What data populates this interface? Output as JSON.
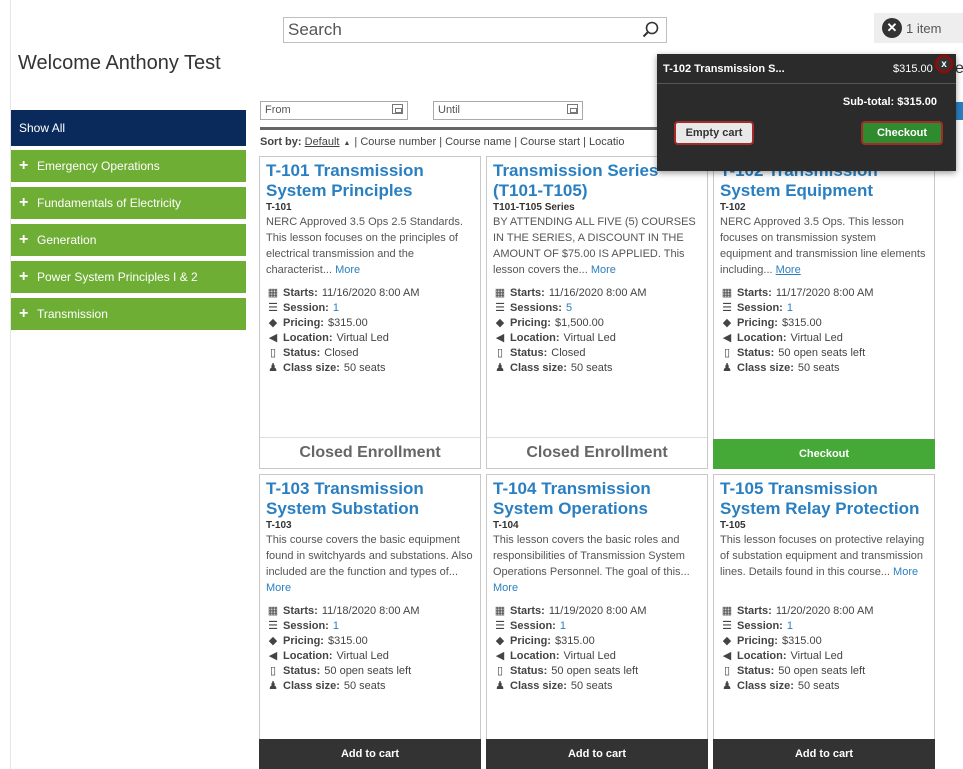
{
  "welcome": "Welcome Anthony Test",
  "search": {
    "placeholder": "Search"
  },
  "cart": {
    "count_label": "1 item"
  },
  "cart_popup": {
    "item_name": "T-102 Transmission S...",
    "item_price": "$315.00",
    "close_label": "x",
    "subtotal": "Sub-total: $315.00",
    "empty_label": "Empty cart",
    "checkout_label": "Checkout"
  },
  "edge_fragment": "es",
  "sidebar": {
    "show_all": "Show All",
    "items": [
      {
        "label": "Emergency Operations"
      },
      {
        "label": "Fundamentals of Electricity"
      },
      {
        "label": "Generation"
      },
      {
        "label": "Power System Principles I & 2"
      },
      {
        "label": "Transmission"
      }
    ]
  },
  "filters": {
    "from": "From",
    "until": "Until"
  },
  "sort": {
    "prefix": "Sort by:",
    "default": "Default",
    "rest": "| Course number | Course name | Course start | Locatio"
  },
  "field_labels": {
    "starts": "Starts:",
    "session": "Session:",
    "sessions": "Sessions:",
    "pricing": "Pricing:",
    "location": "Location:",
    "status": "Status:",
    "class_size": "Class size:"
  },
  "more_label": "More",
  "courses": [
    {
      "title": "T-101 Transmission System Principles",
      "code": "T-101",
      "desc": "NERC Approved 3.5 Ops 2.5 Standards. This lesson focuses on the principles of electrical transmission and the characterist...",
      "starts": "11/16/2020 8:00 AM",
      "session": "1",
      "pricing": "$315.00",
      "location": "Virtual Led",
      "status": "Closed",
      "class_size": "50 seats",
      "action": "Closed Enrollment"
    },
    {
      "title": "Transmission Series (T101-T105)",
      "code": "T101-T105 Series",
      "desc": "BY ATTENDING ALL FIVE (5) COURSES IN THE SERIES, A DISCOUNT IN THE AMOUNT OF $75.00 IS APPLIED. This lesson covers the...",
      "starts": "11/16/2020 8:00 AM",
      "session": "5",
      "pricing": "$1,500.00",
      "location": "Virtual Led",
      "status": "Closed",
      "class_size": "50 seats",
      "action": "Closed Enrollment"
    },
    {
      "title": "T-102 Transmission System Equipment",
      "code": "T-102",
      "desc": "NERC Approved 3.5 Ops.  This lesson focuses on transmission system equipment and transmission line elements including...",
      "starts": "11/17/2020 8:00 AM",
      "session": "1",
      "pricing": "$315.00",
      "location": "Virtual Led",
      "status": "50 open seats left",
      "class_size": "50 seats",
      "action": "Checkout"
    },
    {
      "title": "T-103 Transmission System Substation",
      "code": "T-103",
      "desc": "This course covers the basic equipment found in switchyards and substations. Also included are the function and types of...",
      "starts": "11/18/2020 8:00 AM",
      "session": "1",
      "pricing": "$315.00",
      "location": "Virtual Led",
      "status": "50 open seats left",
      "class_size": "50 seats",
      "action": "Add to cart"
    },
    {
      "title": "T-104 Transmission System Operations",
      "code": "T-104",
      "desc": "This lesson covers the basic roles and responsibilities of Transmission System Operations Personnel. The goal of this...",
      "starts": "11/19/2020 8:00 AM",
      "session": "1",
      "pricing": "$315.00",
      "location": "Virtual Led",
      "status": "50 open seats left",
      "class_size": "50 seats",
      "action": "Add to cart"
    },
    {
      "title": "T-105 Transmission System Relay Protection",
      "code": "T-105",
      "desc": "This lesson focuses on protective relaying of substation equipment and transmission lines. Details found in this course...",
      "starts": "11/20/2020 8:00 AM",
      "session": "1",
      "pricing": "$315.00",
      "location": "Virtual Led",
      "status": "50 open seats left",
      "class_size": "50 seats",
      "action": "Add to cart"
    }
  ]
}
